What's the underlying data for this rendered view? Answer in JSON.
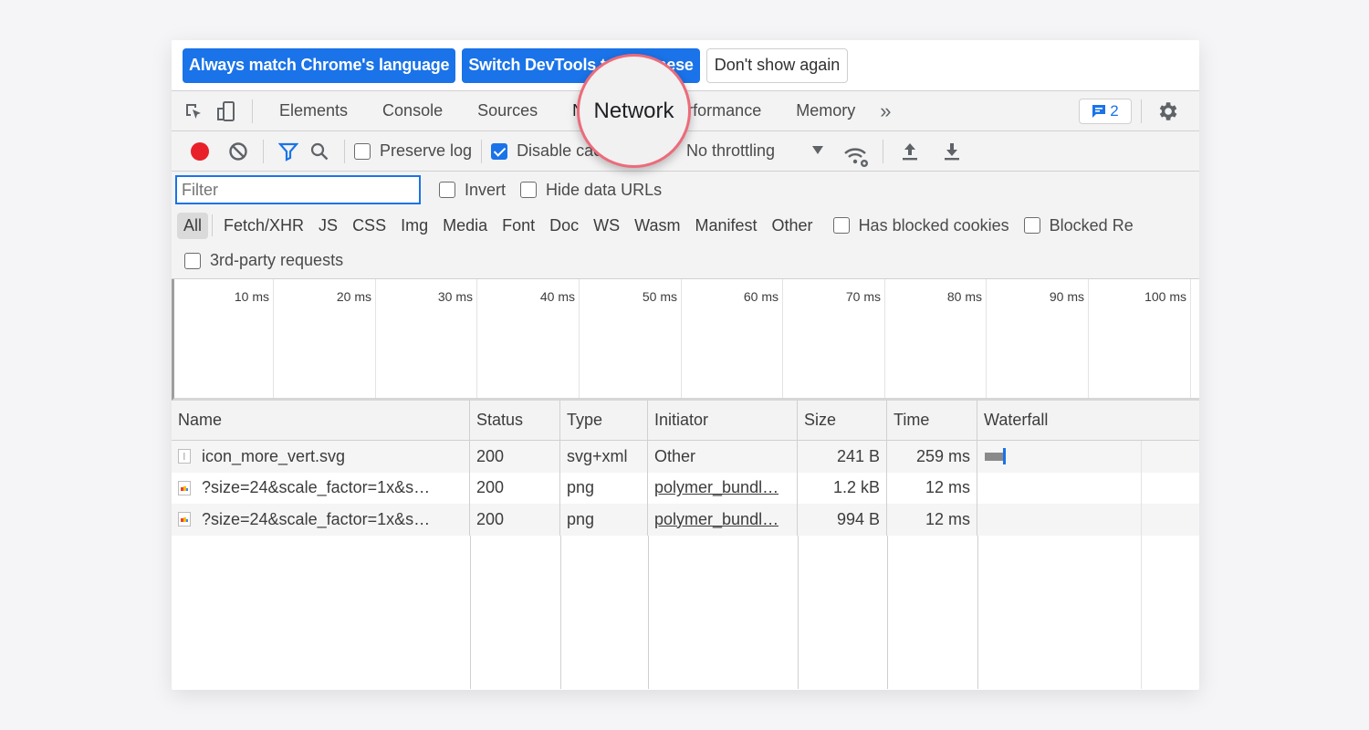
{
  "langbar": {
    "always_match": "Always match Chrome's language",
    "switch_devtools": "Switch DevTools to Japanese",
    "dont_show": "Don't show again"
  },
  "tabs": [
    "Elements",
    "Console",
    "Sources",
    "Network",
    "Performance",
    "Memory"
  ],
  "active_tab": "Network",
  "more_tabs": "»",
  "issues_badge": {
    "count": "2",
    "icon": "message-icon"
  },
  "toolbar": {
    "preserve_log": "Preserve log",
    "disable_cache": "Disable cache",
    "throttling": "No throttling",
    "preserve_log_checked": false,
    "disable_cache_checked": true
  },
  "filter": {
    "placeholder": "Filter",
    "invert": "Invert",
    "hide_data_urls": "Hide data URLs"
  },
  "resource_types": [
    "All",
    "Fetch/XHR",
    "JS",
    "CSS",
    "Img",
    "Media",
    "Font",
    "Doc",
    "WS",
    "Wasm",
    "Manifest",
    "Other"
  ],
  "has_blocked_cookies": "Has blocked cookies",
  "blocked_requests": "Blocked Re",
  "third_party": "3rd-party requests",
  "overview_ticks": [
    "10 ms",
    "20 ms",
    "30 ms",
    "40 ms",
    "50 ms",
    "60 ms",
    "70 ms",
    "80 ms",
    "90 ms",
    "100 ms"
  ],
  "columns": [
    "Name",
    "Status",
    "Type",
    "Initiator",
    "Size",
    "Time",
    "Waterfall"
  ],
  "rows": [
    {
      "name": "icon_more_vert.svg",
      "status": "200",
      "type": "svg+xml",
      "initiator": "Other",
      "size": "241 B",
      "time": "259 ms"
    },
    {
      "name": "?size=24&scale_factor=1x&s…",
      "status": "200",
      "type": "png",
      "initiator": "polymer_bundl…",
      "size": "1.2 kB",
      "time": "12 ms"
    },
    {
      "name": "?size=24&scale_factor=1x&s…",
      "status": "200",
      "type": "png",
      "initiator": "polymer_bundl…",
      "size": "994 B",
      "time": "12 ms"
    }
  ],
  "colors": {
    "accent": "#1a73e8",
    "record": "#e8202a",
    "magnifier_ring": "#ec6b7b"
  }
}
